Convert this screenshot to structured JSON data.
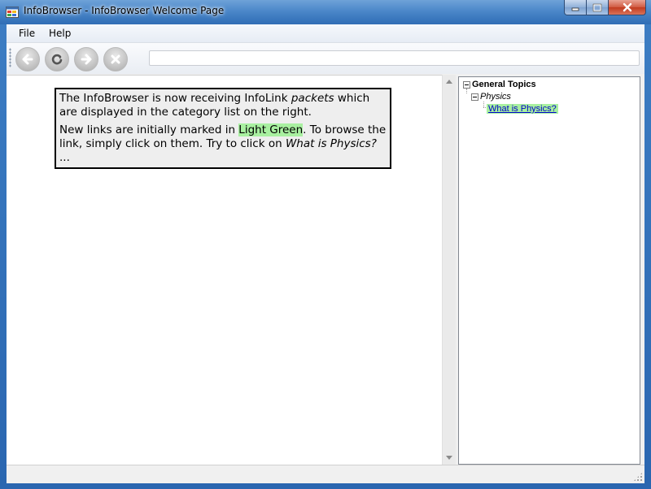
{
  "window": {
    "title": "InfoBrowser - InfoBrowser Welcome Page"
  },
  "menu": {
    "items": [
      {
        "label": "File"
      },
      {
        "label": "Help"
      }
    ]
  },
  "toolbar": {
    "buttons": [
      {
        "name": "back",
        "icon": "arrow-left-icon"
      },
      {
        "name": "refresh",
        "icon": "refresh-icon"
      },
      {
        "name": "forward",
        "icon": "arrow-right-icon"
      },
      {
        "name": "stop",
        "icon": "close-x-icon"
      }
    ],
    "address_value": ""
  },
  "welcome": {
    "p1_a": "The InfoBrowser is now receiving InfoLink ",
    "p1_em": "packets",
    "p1_b": " which are displayed in the category list on the right.",
    "p2_a": "New links are initially marked in ",
    "p2_highlight": "Light Green",
    "p2_b": ". To browse the link, simply click on them. Try to click on ",
    "p2_em": "What is Physics?",
    "p2_c": " ..."
  },
  "tree": {
    "root": "General Topics",
    "child": "Physics",
    "leaf": "What is Physics?"
  },
  "colors": {
    "new_link_highlight": "#a8f0a0",
    "title_bar": "#4b87c9"
  }
}
